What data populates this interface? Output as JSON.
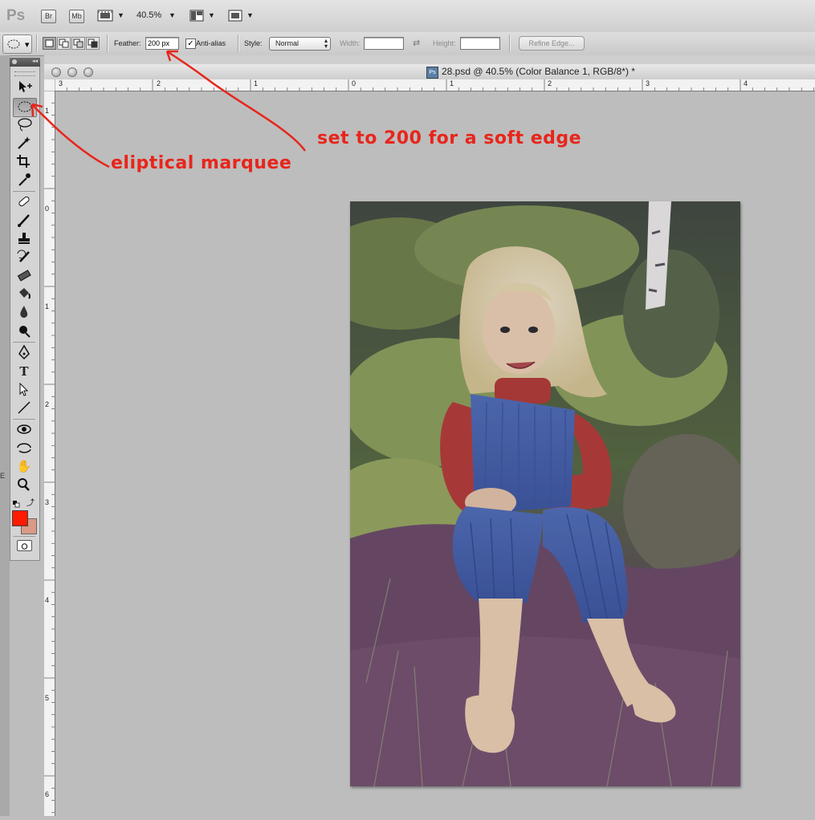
{
  "app": {
    "logo": "Ps",
    "bridge_btn": "Br",
    "minibridge_btn": "Mb",
    "zoom": "40.5%"
  },
  "options": {
    "feather_label": "Feather:",
    "feather_value": "200 px",
    "antialias_label": "Anti-alias",
    "antialias_checked": true,
    "style_label": "Style:",
    "style_value": "Normal",
    "width_label": "Width:",
    "height_label": "Height:",
    "refine_label": "Refine Edge..."
  },
  "document": {
    "title": "28.psd @ 40.5% (Color Balance 1, RGB/8*) *"
  },
  "rulers": {
    "h_labels": [
      "3",
      "2",
      "1",
      "0",
      "1",
      "2",
      "3",
      "4"
    ],
    "v_labels": [
      "1",
      "0",
      "1",
      "2",
      "3",
      "4",
      "5",
      "6"
    ]
  },
  "annotations": {
    "feather_note": "set to 200 for a soft edge",
    "marquee_note": "eliptical marquee",
    "color": "#e8251b"
  },
  "colors": {
    "foreground": "#ff1a00",
    "background": "#d99a86"
  },
  "tools": [
    "move-icon",
    "elliptical-marquee-icon",
    "lasso-icon",
    "magic-wand-icon",
    "crop-icon",
    "eyedropper-icon",
    "healing-brush-icon",
    "brush-icon",
    "clone-stamp-icon",
    "history-brush-icon",
    "eraser-icon",
    "paint-bucket-icon",
    "blur-icon",
    "dodge-icon",
    "pen-icon",
    "type-icon",
    "path-selection-icon",
    "line-icon",
    "3d-rotate-icon",
    "3d-orbit-icon",
    "hand-icon",
    "zoom-icon"
  ]
}
